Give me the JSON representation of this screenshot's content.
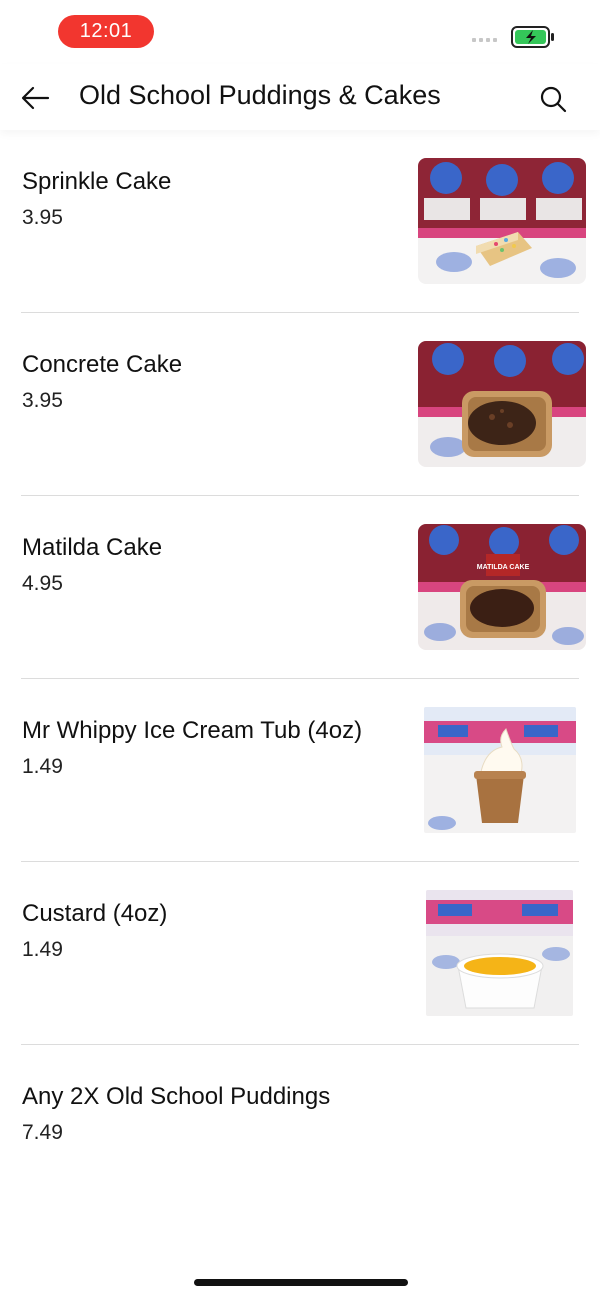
{
  "status": {
    "time": "12:01"
  },
  "header": {
    "title": "Old School Puddings & Cakes"
  },
  "items": [
    {
      "name": "Sprinkle Cake",
      "price": "3.95",
      "image": "sprinkle-cake-photo"
    },
    {
      "name": "Concrete Cake",
      "price": "3.95",
      "image": "concrete-cake-photo"
    },
    {
      "name": "Matilda Cake",
      "price": "4.95",
      "image": "matilda-cake-photo",
      "image_text": "MATILDA CAKE"
    },
    {
      "name": "Mr Whippy Ice Cream Tub (4oz)",
      "price": "1.49",
      "image": "ice-cream-tub-photo"
    },
    {
      "name": "Custard (4oz)",
      "price": "1.49",
      "image": "custard-photo"
    },
    {
      "name": "Any 2X Old School Puddings",
      "price": "7.49"
    }
  ],
  "colors": {
    "status_pill": "#f2362f",
    "battery": "#34c759"
  }
}
